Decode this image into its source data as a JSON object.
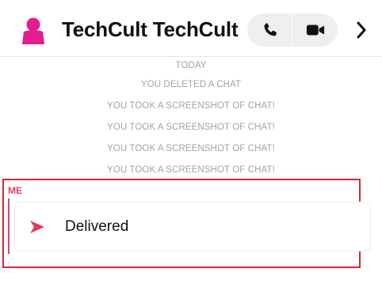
{
  "header": {
    "title": "TechCult TechCult",
    "avatar_icon": "user-silhouette-icon",
    "avatar_color": "#e11d8f",
    "voice_call_icon": "phone-icon",
    "video_call_icon": "video-camera-icon",
    "more_icon": "chevron-right-icon"
  },
  "messages": {
    "date_label": "TODAY",
    "system": [
      "YOU DELETED A CHAT",
      "YOU TOOK A SCREENSHOT OF CHAT!",
      "YOU TOOK A SCREENSHOT OF CHAT!",
      "YOU TOOK A SCREENSHOT OF CHAT!",
      "YOU TOOK A SCREENSHOT OF CHAT!"
    ]
  },
  "last_message": {
    "sender": "ME",
    "status_icon": "sent-arrow-icon",
    "status": "Delivered",
    "accent_color": "#e0445e",
    "highlight_color": "#d5273a"
  }
}
